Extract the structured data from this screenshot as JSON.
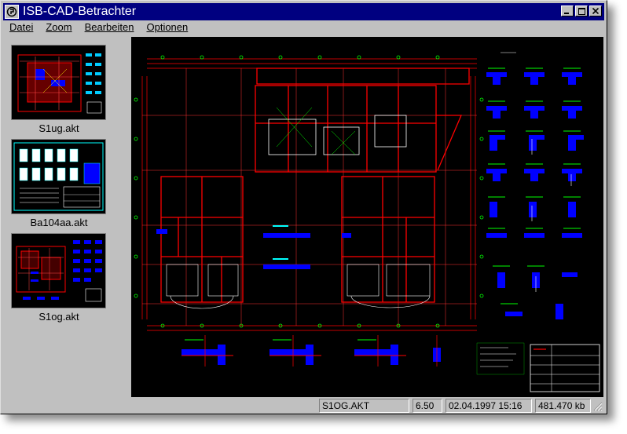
{
  "window": {
    "title": "ISB-CAD-Betrachter",
    "buttons": {
      "minimize": "_",
      "maximize": "□",
      "close": "✕"
    }
  },
  "menu": {
    "items": [
      {
        "label": "Datei"
      },
      {
        "label": "Zoom"
      },
      {
        "label": "Bearbeiten"
      },
      {
        "label": "Optionen"
      }
    ]
  },
  "thumbnails": [
    {
      "label": "S1ug.akt"
    },
    {
      "label": "Ba104aa.akt"
    },
    {
      "label": "S1og.akt"
    }
  ],
  "status": {
    "filename": "S1OG.AKT",
    "version": "6.50",
    "datetime": "02.04.1997 15:16",
    "size": "481.470 kb"
  },
  "colors": {
    "title_bar": "#000080",
    "cad_background": "#000000",
    "cad_red": "#ff0000",
    "cad_blue": "#0000ff",
    "cad_green": "#00ff00",
    "cad_white": "#ffffff",
    "cad_cyan": "#00ffff"
  }
}
